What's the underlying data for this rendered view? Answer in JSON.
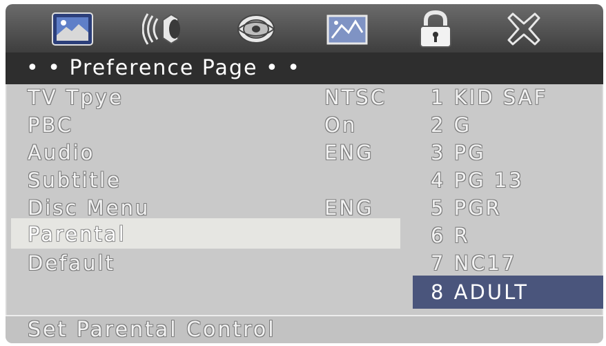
{
  "toolbar": {
    "icons": [
      {
        "name": "general-setup-icon"
      },
      {
        "name": "audio-setup-icon"
      },
      {
        "name": "video-setup-icon"
      },
      {
        "name": "display-setup-icon"
      },
      {
        "name": "password-lock-icon"
      },
      {
        "name": "exit-icon"
      }
    ]
  },
  "page": {
    "title": "• •  Preference Page  • •"
  },
  "menu": {
    "items": [
      {
        "label": "TV Tpye",
        "value": "NTSC"
      },
      {
        "label": "PBC",
        "value": "On"
      },
      {
        "label": "Audio",
        "value": "ENG"
      },
      {
        "label": "Subtitle",
        "value": ""
      },
      {
        "label": "Disc Menu",
        "value": "ENG"
      },
      {
        "label": "Parental",
        "value": ""
      },
      {
        "label": "Default",
        "value": ""
      }
    ],
    "selected_index": 5
  },
  "parental_options": {
    "items": [
      "1 KID SAF",
      "2 G",
      "3 PG",
      "4 PG 13",
      "5 PGR",
      "6 R",
      "7 NC17",
      "8 ADULT"
    ],
    "selected_index": 7
  },
  "status": {
    "text": "Set Parental Control"
  },
  "colors": {
    "background": "#c9c9c9",
    "title_bar": "#2e2e2e",
    "highlight_row": "#e6e6e2",
    "selected_option": "#4a557c"
  }
}
